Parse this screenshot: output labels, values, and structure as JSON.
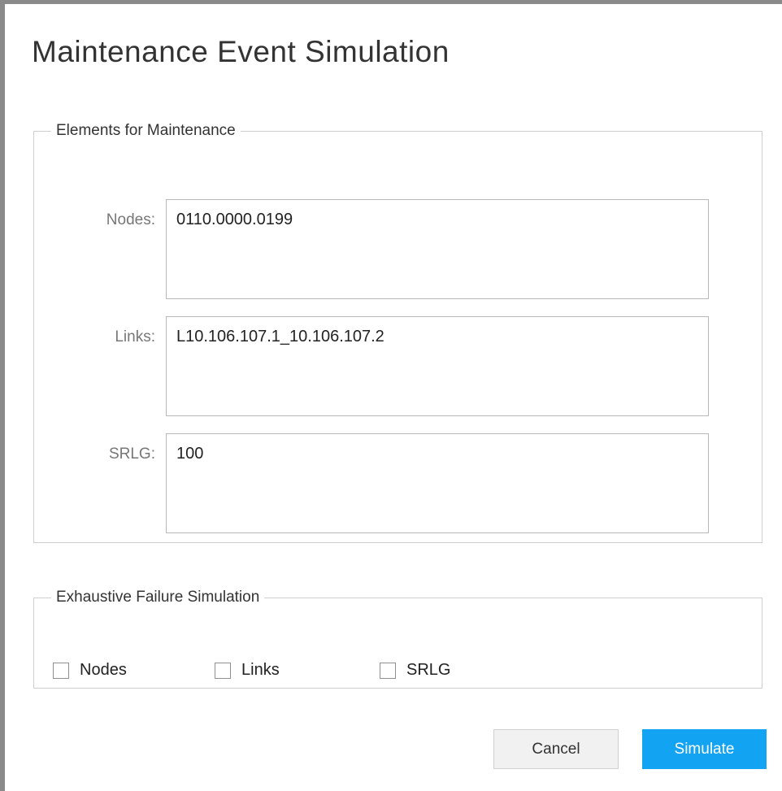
{
  "dialog": {
    "title": "Maintenance Event Simulation"
  },
  "maintenance": {
    "legend": "Elements for Maintenance",
    "nodes": {
      "label": "Nodes:",
      "value": "0110.0000.0199"
    },
    "links": {
      "label": "Links:",
      "value": "L10.106.107.1_10.106.107.2"
    },
    "srlg": {
      "label": "SRLG:",
      "value": "100"
    }
  },
  "exhaustive": {
    "legend": "Exhaustive Failure Simulation",
    "options": [
      {
        "label": "Nodes",
        "checked": false
      },
      {
        "label": "Links",
        "checked": false
      },
      {
        "label": "SRLG",
        "checked": false
      }
    ]
  },
  "buttons": {
    "cancel": "Cancel",
    "simulate": "Simulate"
  },
  "colors": {
    "primary": "#13a3f3",
    "window_border": "#8a8a8a"
  }
}
